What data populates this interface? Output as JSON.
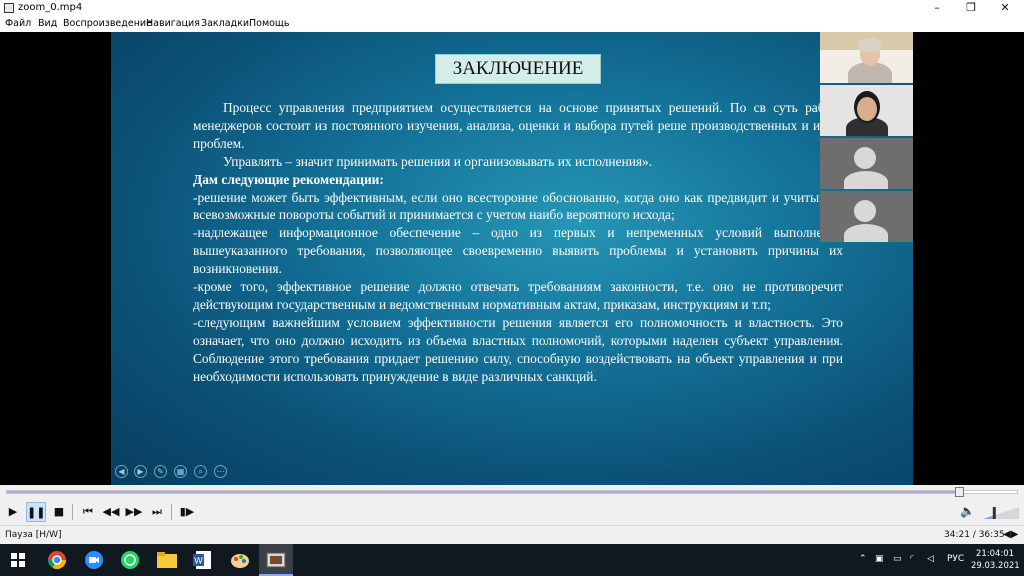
{
  "window": {
    "title": "zoom_0.mp4",
    "minimize": "–",
    "restore": "❐",
    "close": "✕"
  },
  "menu": [
    "Файл",
    "Вид",
    "Воспроизведение",
    "Навигация",
    "Закладки",
    "Помощь"
  ],
  "slide": {
    "title": "ЗАКЛЮЧЕНИЕ",
    "paragraphs": [
      {
        "text": "Процесс управления предприятием осуществляется на основе принятых решений. По св суть работа менеджеров состоит из постоянного изучения, анализа, оценки и выбора путей реше производственных и иных проблем.",
        "style": "indent"
      },
      {
        "text": "Управлять – значит принимать решения и организовывать их исполнения».",
        "style": "indent"
      },
      {
        "text": "Дам следующие рекомендации:",
        "style": "bold"
      },
      {
        "text": "-решение может быть эффективным, если оно всесторонне обоснованно, когда оно как предвидит и учитывает всевозможные повороты событий и принимается с учетом наибо вероятного исхода;",
        "style": "plain"
      },
      {
        "text": "-надлежащее информационное обеспечение – одно из первых и непременных условий выполнения вышеуказанного требования, позволяющее своевременно выявить проблемы и установить причины их возникновения.",
        "style": "plain"
      },
      {
        "text": "-кроме того, эффективное решение должно отвечать требованиям законности, т.е. оно не противоречит действующим государственным и ведомственным нормативным актам, приказам, инструкциям и т.п;",
        "style": "plain"
      },
      {
        "text": "-следующим важнейшим условием эффективности решения является его полномочность и властность. Это означает, что оно должно исходить из объема властных полномочий, которыми наделен субъект управления. Соблюдение этого требования придает решению силу, способную воздействовать на объект управления и при необходимости использовать принуждение в виде различных санкций.",
        "style": "plain"
      }
    ]
  },
  "slide_controls": [
    "prev-icon",
    "next-icon",
    "pen-icon",
    "slides-icon",
    "zoom-icon",
    "more-icon"
  ],
  "participants": [
    {
      "icon": "video-person-icon",
      "type": "video"
    },
    {
      "icon": "video-person-icon",
      "type": "video"
    },
    {
      "icon": "avatar-placeholder-icon",
      "type": "placeholder"
    },
    {
      "icon": "avatar-placeholder-icon",
      "type": "placeholder"
    }
  ],
  "player": {
    "progress": 0.943,
    "volume": 0.3,
    "status": "Пауза [H/W]",
    "time": "34:21 / 36:35"
  },
  "tray": {
    "lang": "РУС",
    "time": "21:04:01",
    "date": "29.03.2021"
  },
  "colors": {
    "slide_bg": "#137096",
    "title_box": "#d2eee8",
    "taskbar": "#101820",
    "active_button": "#cde3f7"
  }
}
